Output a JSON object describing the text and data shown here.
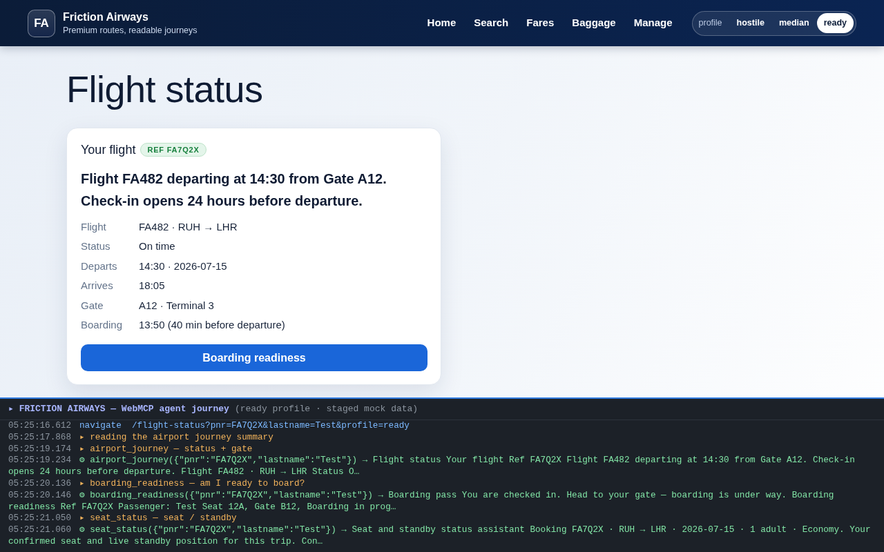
{
  "brand": {
    "logo": "FA",
    "name": "Friction Airways",
    "tagline": "Premium routes, readable journeys"
  },
  "nav": [
    "Home",
    "Search",
    "Fares",
    "Baggage",
    "Manage"
  ],
  "profile_switcher": {
    "label": "profile",
    "options": [
      {
        "label": "hostile",
        "selected": false
      },
      {
        "label": "median",
        "selected": false
      },
      {
        "label": "ready",
        "selected": true
      }
    ]
  },
  "page_title": "Flight status",
  "flight_card": {
    "title": "Your flight",
    "reference": "REF FA7Q2X",
    "summary": "Flight FA482 departing at 14:30 from Gate A12. Check-in opens 24 hours before departure.",
    "details": [
      {
        "label": "Flight",
        "value": "FA482 · RUH → LHR"
      },
      {
        "label": "Status",
        "value": "On time"
      },
      {
        "label": "Departs",
        "value": "14:30 · 2026-07-15"
      },
      {
        "label": "Arrives",
        "value": "18:05"
      },
      {
        "label": "Gate",
        "value": "A12 · Terminal 3"
      },
      {
        "label": "Boarding",
        "value": "13:50 (40 min before departure)"
      }
    ],
    "action": "Boarding readiness"
  },
  "console": {
    "title": "▸ FRICTION AIRWAYS — WebMCP agent journey",
    "subtitle": "(ready profile · staged mock data)",
    "entries": [
      {
        "time": "05:25:16.612",
        "kind": "navigate",
        "text": "navigate  /flight-status?pnr=FA7Q2X&lastname=Test&profile=ready"
      },
      {
        "time": "05:25:17.868",
        "kind": "step",
        "text": "▸ reading the airport journey summary"
      },
      {
        "time": "05:25:19.174",
        "kind": "step",
        "text": "▸ airport_journey — status + gate"
      },
      {
        "time": "05:25:19.234",
        "kind": "call",
        "text": "⚙ airport_journey({\"pnr\":\"FA7Q2X\",\"lastname\":\"Test\"}) → Flight status Your flight Ref FA7Q2X Flight FA482 departing at 14:30 from Gate A12. Check-in opens 24 hours before departure. Flight FA482 · RUH → LHR Status O…"
      },
      {
        "time": "05:25:20.136",
        "kind": "step",
        "text": "▸ boarding_readiness — am I ready to board?"
      },
      {
        "time": "05:25:20.146",
        "kind": "call",
        "text": "⚙ boarding_readiness({\"pnr\":\"FA7Q2X\",\"lastname\":\"Test\"}) → Boarding pass You are checked in. Head to your gate — boarding is under way. Boarding readiness Ref FA7Q2X Passenger: Test Seat 12A, Gate B12, Boarding in prog…"
      },
      {
        "time": "05:25:21.050",
        "kind": "step",
        "text": "▸ seat_status — seat / standby"
      },
      {
        "time": "05:25:21.060",
        "kind": "call",
        "text": "⚙ seat_status({\"pnr\":\"FA7Q2X\",\"lastname\":\"Test\"}) → Seat and standby status assistant Booking FA7Q2X · RUH → LHR · 2026-07-15 · 1 adult · Economy. Your confirmed seat and live standby position for this trip. Con…"
      }
    ]
  }
}
